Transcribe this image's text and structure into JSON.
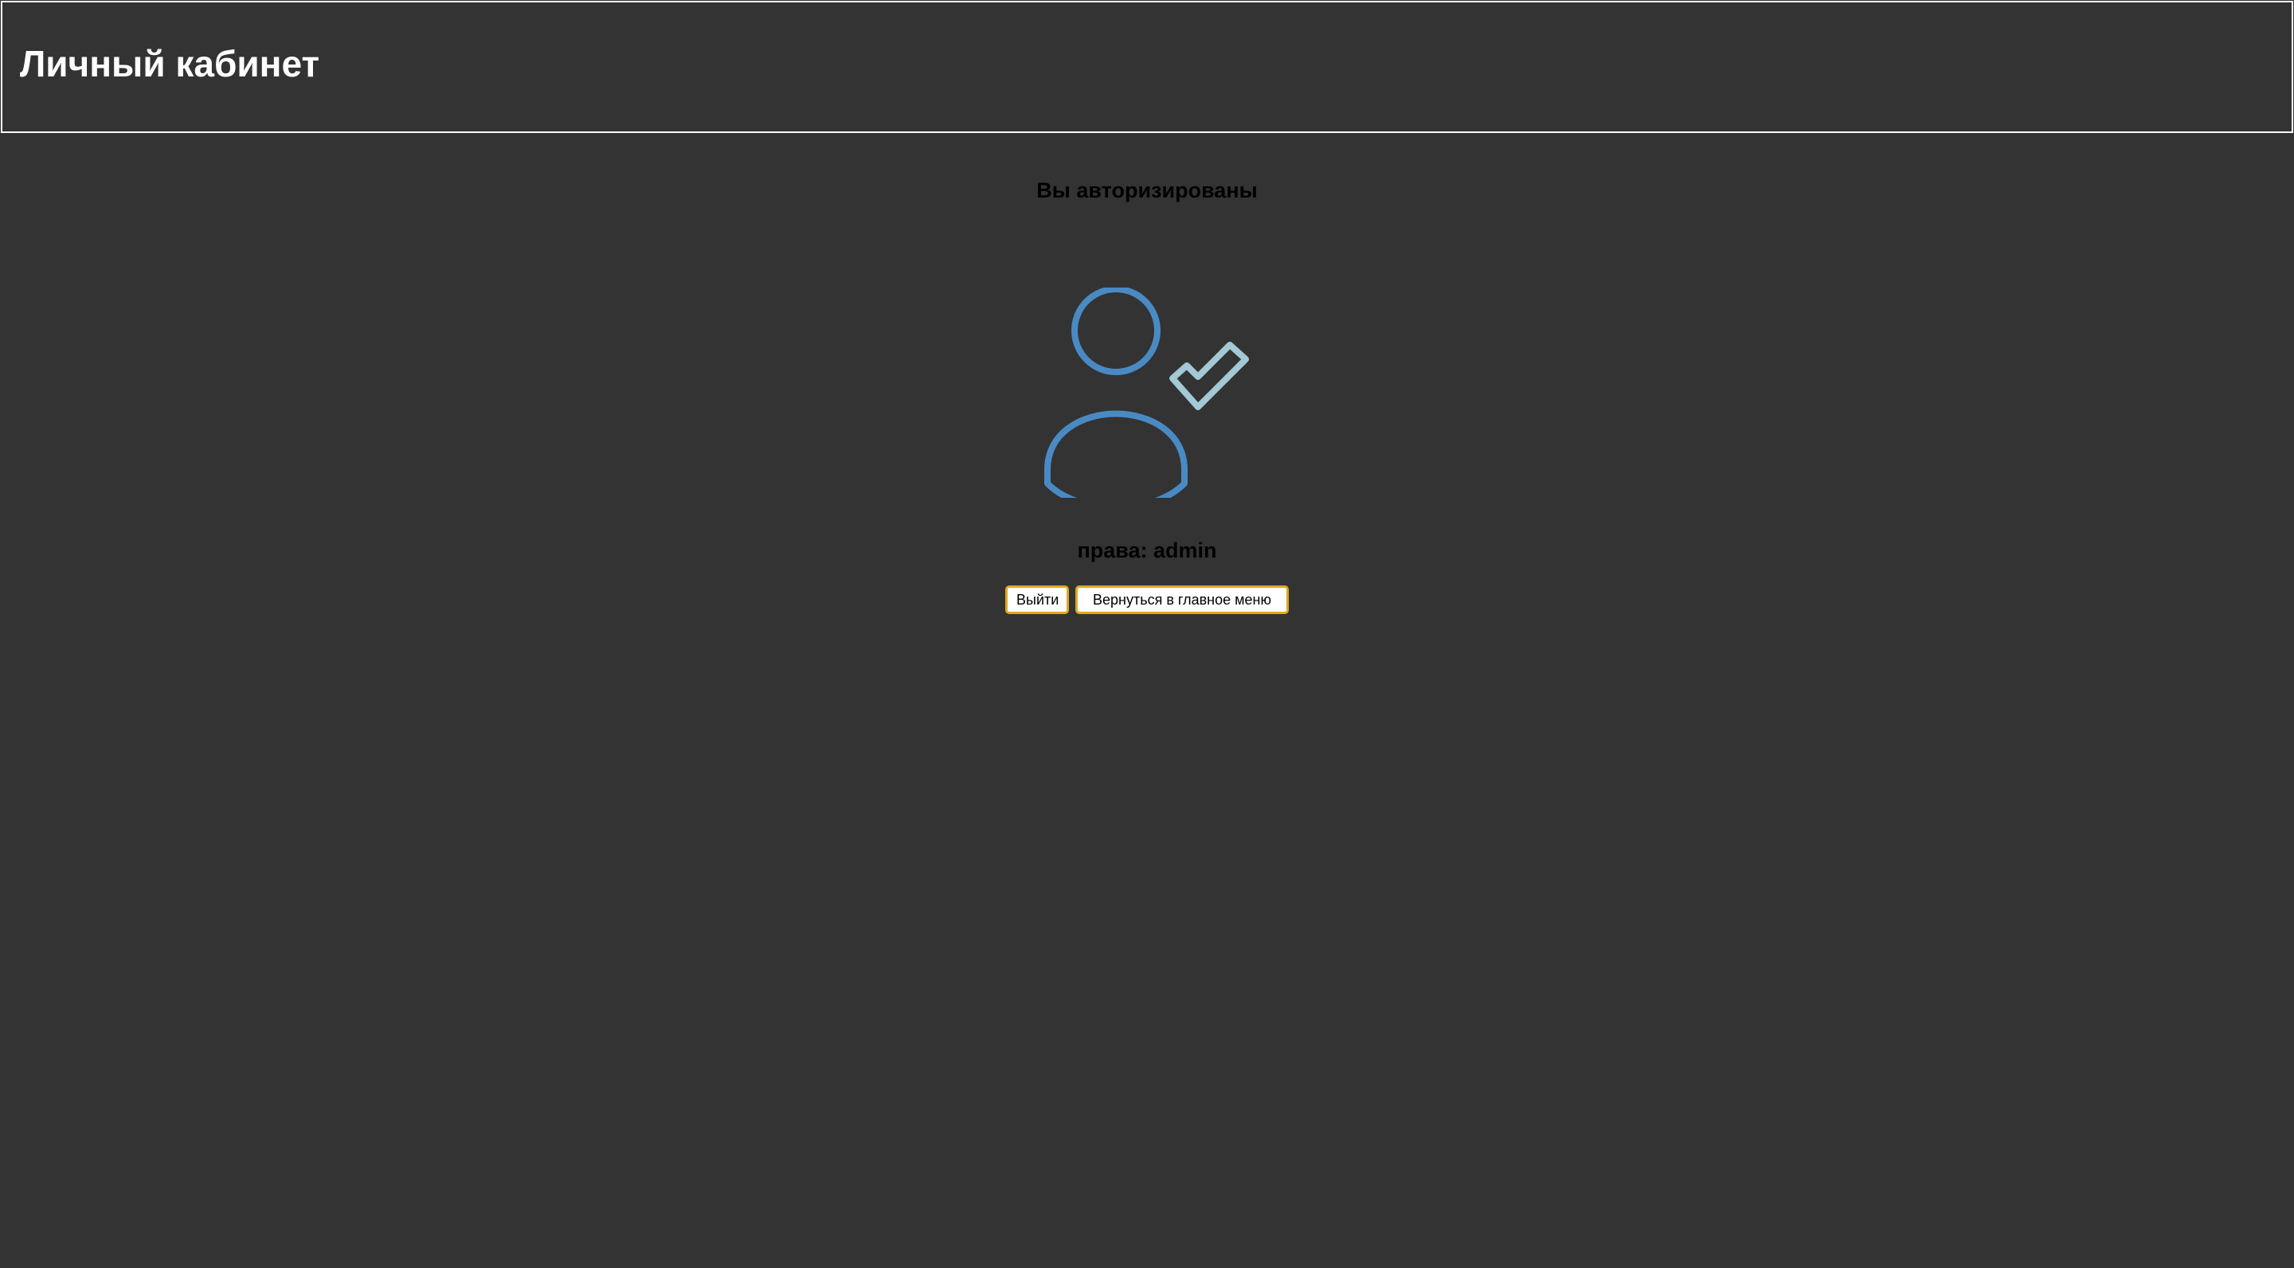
{
  "header": {
    "title": "Личный кабинет"
  },
  "main": {
    "status_heading": "Вы авторизированы",
    "avatar_icon": "user-check-icon",
    "rights_label": "права:",
    "rights_value": "admin",
    "buttons": {
      "logout_label": "Выйти",
      "home_label": "Вернуться в главное меню"
    }
  },
  "colors": {
    "background": "#333333",
    "header_border": "#ffffff",
    "icon_user": "#4a8ac4",
    "icon_check": "#a3c8d6",
    "button_border": "#e0a820"
  }
}
